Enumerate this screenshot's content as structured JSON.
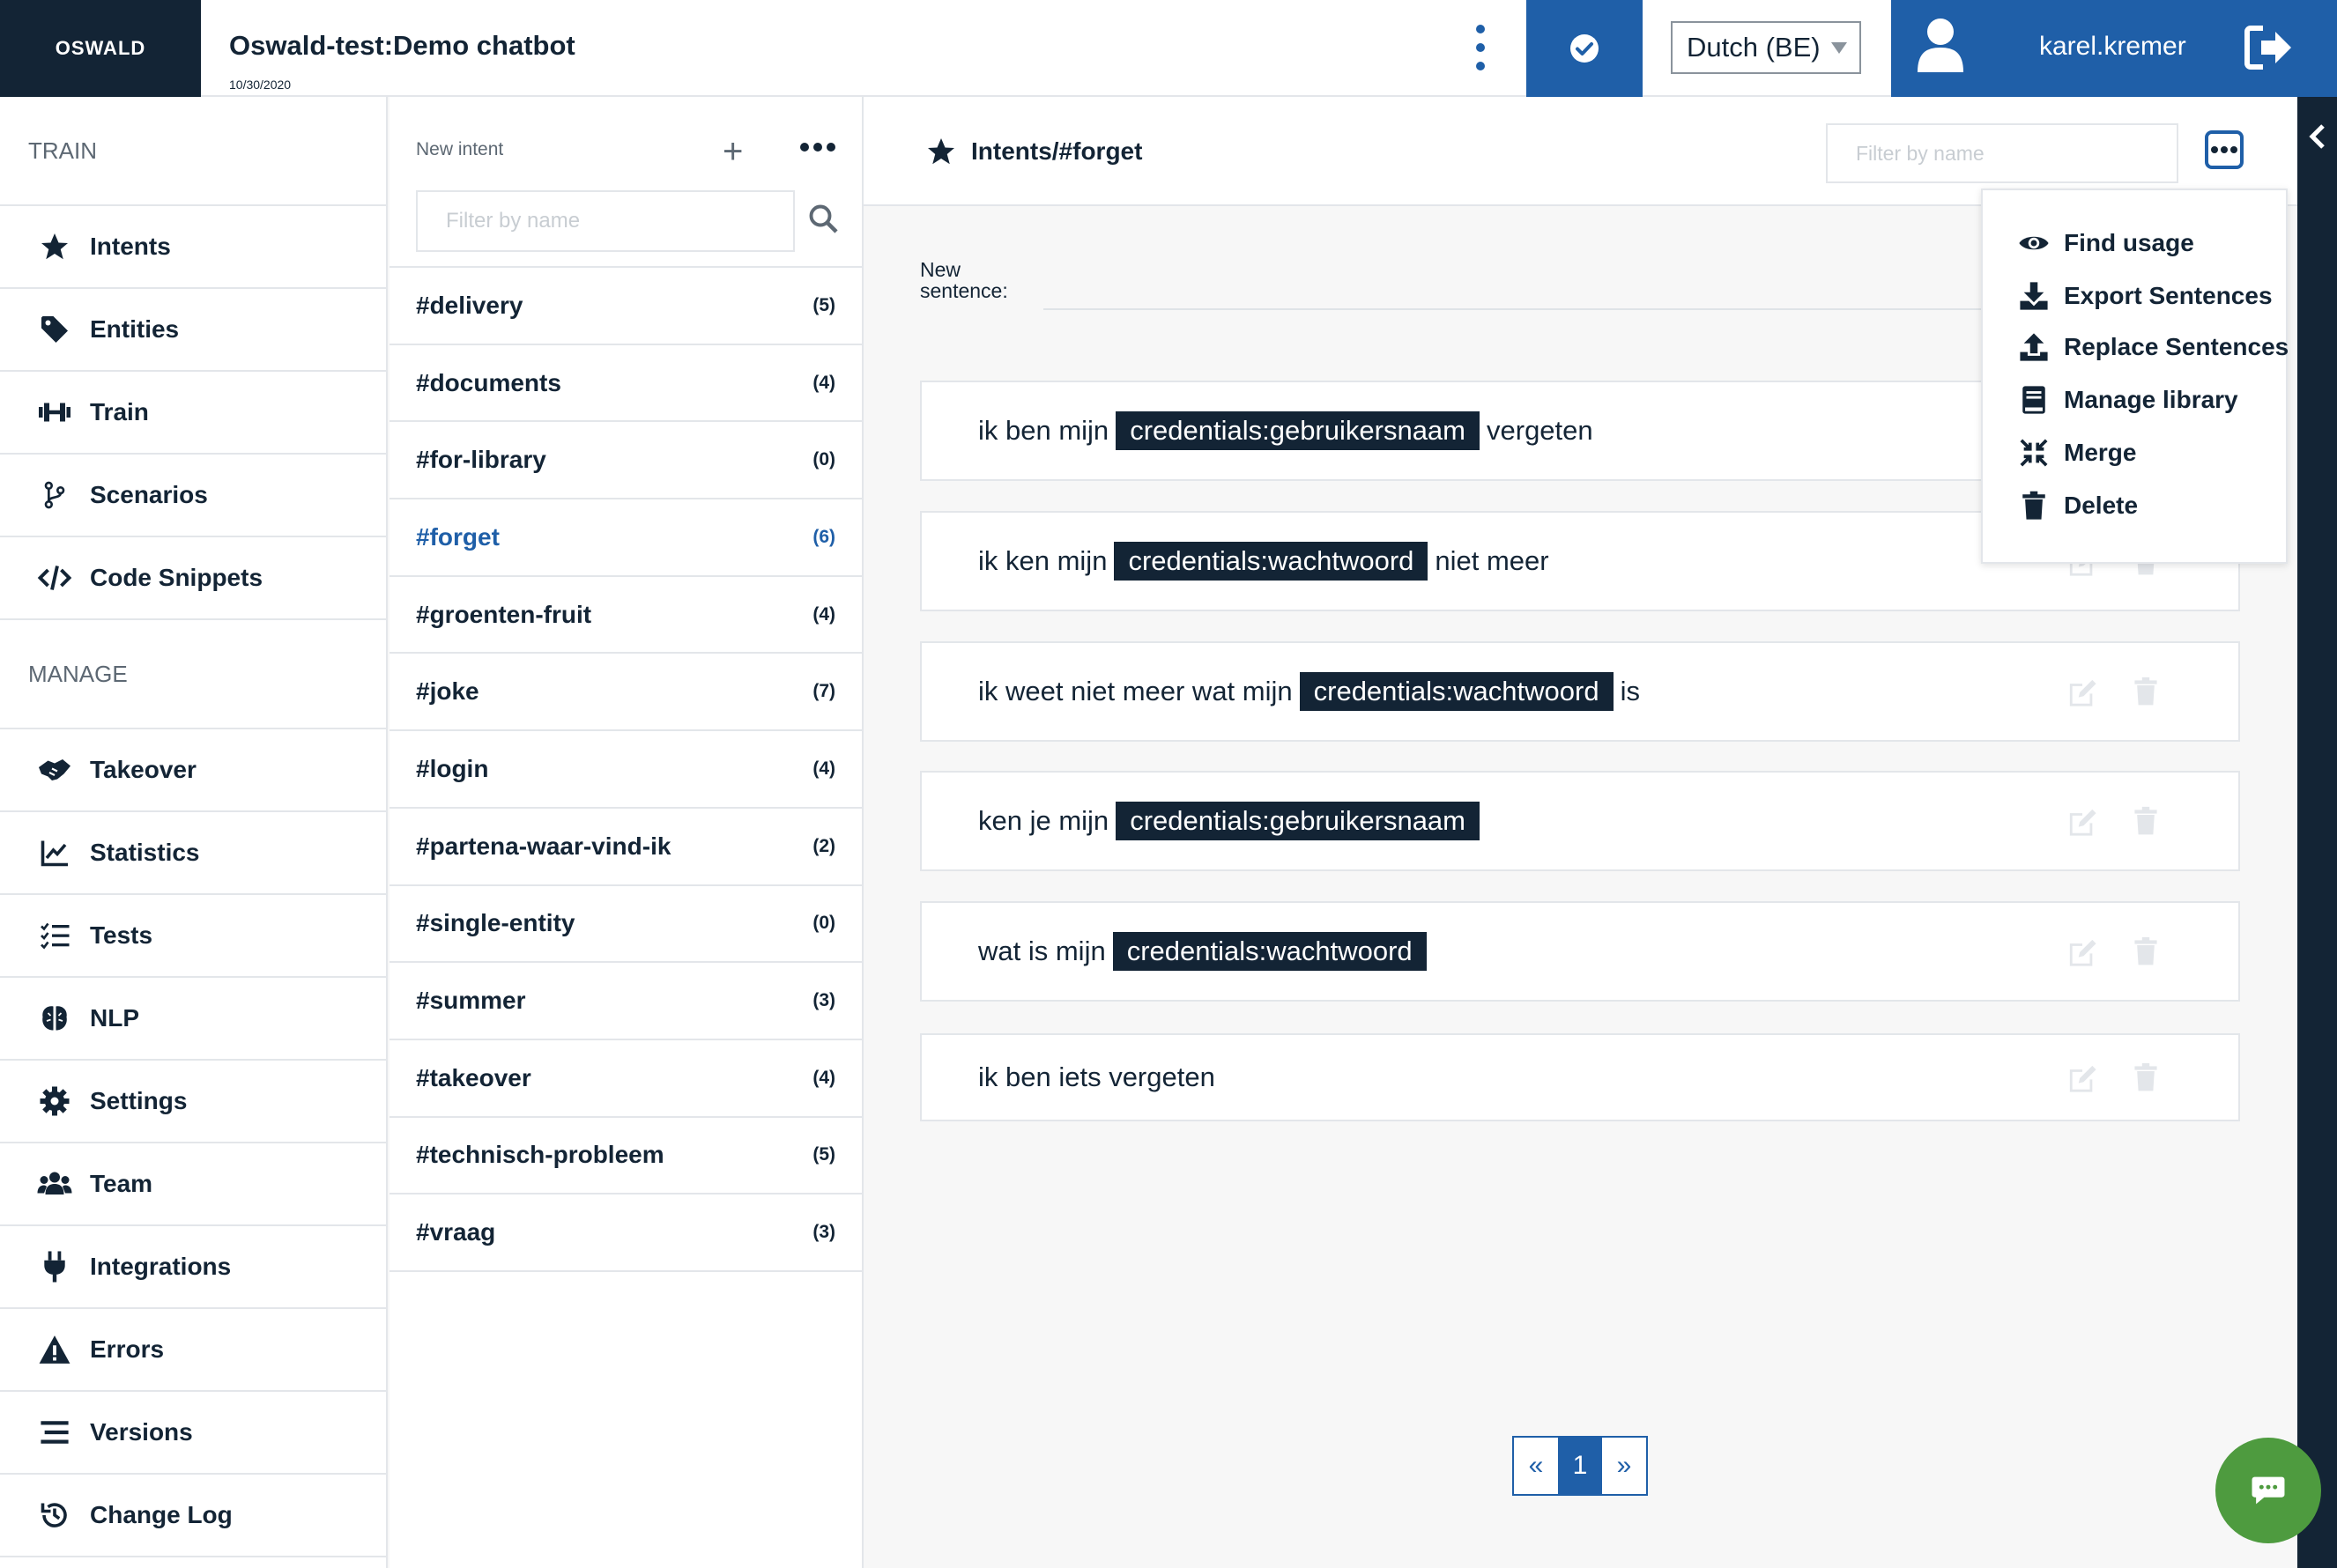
{
  "header": {
    "logo": "OSWALD",
    "title": "Oswald-test:Demo chatbot",
    "date": "10/30/2020",
    "language": "Dutch (BE)",
    "username": "karel.kremer"
  },
  "nav": {
    "train_section": "TRAIN",
    "train_items": [
      {
        "label": "Intents",
        "icon": "star-icon"
      },
      {
        "label": "Entities",
        "icon": "tag-icon"
      },
      {
        "label": "Train",
        "icon": "dumbbell-icon"
      },
      {
        "label": "Scenarios",
        "icon": "branch-icon"
      },
      {
        "label": "Code Snippets",
        "icon": "code-icon"
      }
    ],
    "manage_section": "MANAGE",
    "manage_items": [
      {
        "label": "Takeover",
        "icon": "handshake-icon"
      },
      {
        "label": "Statistics",
        "icon": "chart-line-icon"
      },
      {
        "label": "Tests",
        "icon": "list-check-icon"
      },
      {
        "label": "NLP",
        "icon": "brain-icon"
      },
      {
        "label": "Settings",
        "icon": "gear-icon"
      },
      {
        "label": "Team",
        "icon": "users-icon"
      },
      {
        "label": "Integrations",
        "icon": "plug-icon"
      },
      {
        "label": "Errors",
        "icon": "warning-icon"
      },
      {
        "label": "Versions",
        "icon": "bars-icon"
      },
      {
        "label": "Change Log",
        "icon": "history-icon"
      }
    ]
  },
  "intents": {
    "new_label": "New intent",
    "search_placeholder": "Filter by name",
    "items": [
      {
        "name": "#delivery",
        "count": "(5)"
      },
      {
        "name": "#documents",
        "count": "(4)"
      },
      {
        "name": "#for-library",
        "count": "(0)"
      },
      {
        "name": "#forget",
        "count": "(6)",
        "active": true
      },
      {
        "name": "#groenten-fruit",
        "count": "(4)"
      },
      {
        "name": "#joke",
        "count": "(7)"
      },
      {
        "name": "#login",
        "count": "(4)"
      },
      {
        "name": "#partena-waar-vind-ik",
        "count": "(2)"
      },
      {
        "name": "#single-entity",
        "count": "(0)"
      },
      {
        "name": "#summer",
        "count": "(3)"
      },
      {
        "name": "#takeover",
        "count": "(4)"
      },
      {
        "name": "#technisch-probleem",
        "count": "(5)"
      },
      {
        "name": "#vraag",
        "count": "(3)"
      }
    ]
  },
  "main": {
    "breadcrumb": "Intents/#forget",
    "filter_placeholder": "Filter by name",
    "new_sentence_label": "New sentence:",
    "sentences": [
      {
        "parts": [
          {
            "t": "text",
            "v": "ik ben mijn"
          },
          {
            "t": "entity",
            "v": "credentials:gebruikersnaam"
          },
          {
            "t": "text",
            "v": "vergeten"
          }
        ]
      },
      {
        "parts": [
          {
            "t": "text",
            "v": "ik ken mijn"
          },
          {
            "t": "entity",
            "v": "credentials:wachtwoord"
          },
          {
            "t": "text",
            "v": "niet meer"
          }
        ]
      },
      {
        "parts": [
          {
            "t": "text",
            "v": "ik weet niet meer wat mijn"
          },
          {
            "t": "entity",
            "v": "credentials:wachtwoord"
          },
          {
            "t": "text",
            "v": "is"
          }
        ]
      },
      {
        "parts": [
          {
            "t": "text",
            "v": "ken je mijn"
          },
          {
            "t": "entity",
            "v": "credentials:gebruikersnaam"
          }
        ]
      },
      {
        "parts": [
          {
            "t": "text",
            "v": "wat is mijn"
          },
          {
            "t": "entity",
            "v": "credentials:wachtwoord"
          }
        ]
      },
      {
        "parts": [
          {
            "t": "text",
            "v": "ik ben iets vergeten"
          }
        ]
      }
    ],
    "pagination": {
      "prev": "«",
      "current": "1",
      "next": "»"
    }
  },
  "dropdown": {
    "items": [
      {
        "label": "Find usage",
        "icon": "eye-icon"
      },
      {
        "label": "Export Sentences",
        "icon": "download-icon"
      },
      {
        "label": "Replace Sentences",
        "icon": "upload-icon"
      },
      {
        "label": "Manage library",
        "icon": "book-icon"
      },
      {
        "label": "Merge",
        "icon": "compress-icon"
      },
      {
        "label": "Delete",
        "icon": "trash-icon"
      }
    ]
  },
  "colors": {
    "navy": "#132435",
    "brand_blue": "#1f5fa8",
    "chat_green": "#4e9b3f",
    "border": "#e3e6ea"
  }
}
